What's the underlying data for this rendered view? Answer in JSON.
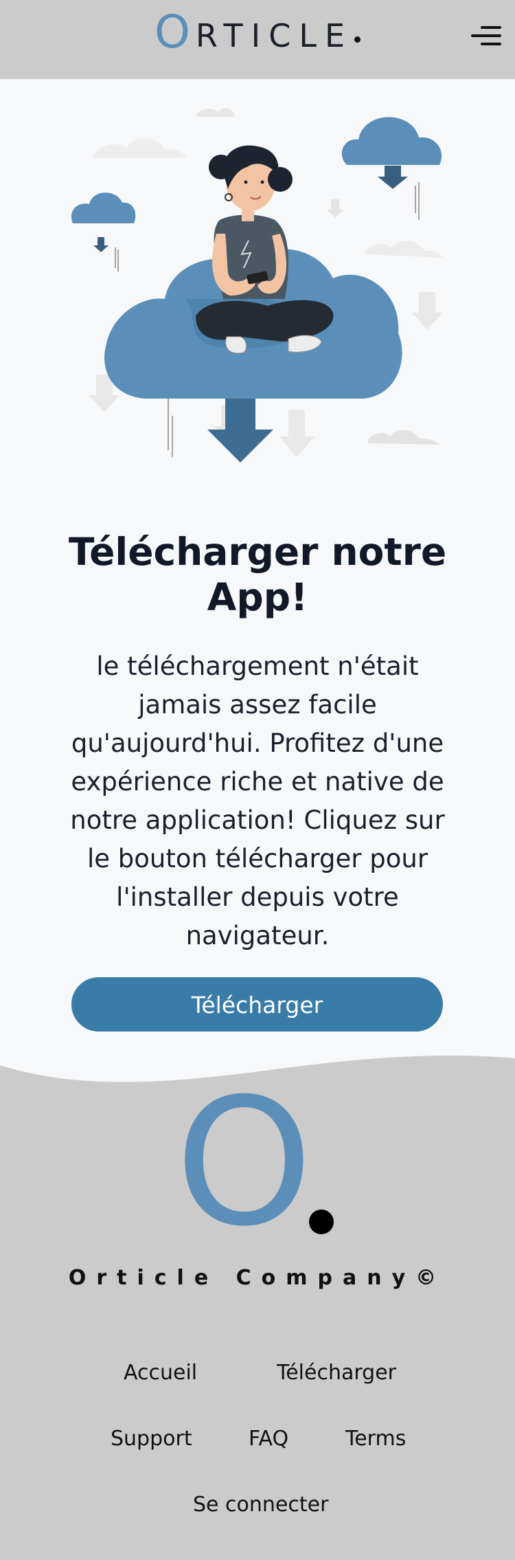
{
  "header": {
    "logo_letter": "O",
    "logo_text": "RTICLE",
    "menu_icon": "hamburger-menu-icon"
  },
  "hero": {
    "illustration": "person-downloading-from-cloud",
    "title": "Télécharger notre App!",
    "description": "le téléchargement n'était jamais assez facile qu'aujourd'hui. Profitez d'une expérience riche et native de notre application! Cliquez sur le bouton télécharger pour l'installer depuis votre navigateur.",
    "button_label": "Télécharger"
  },
  "footer": {
    "logo_letter": "O",
    "company": "Orticle Company©",
    "links": {
      "home": "Accueil",
      "download": "Télécharger",
      "support": "Support",
      "faq": "FAQ",
      "terms": "Terms",
      "login": "Se connecter"
    }
  },
  "colors": {
    "accent": "#397ca8",
    "logo_blue": "#5b8fb9",
    "page_bg": "#cbcbcb",
    "section_bg": "#f7f8fa"
  }
}
